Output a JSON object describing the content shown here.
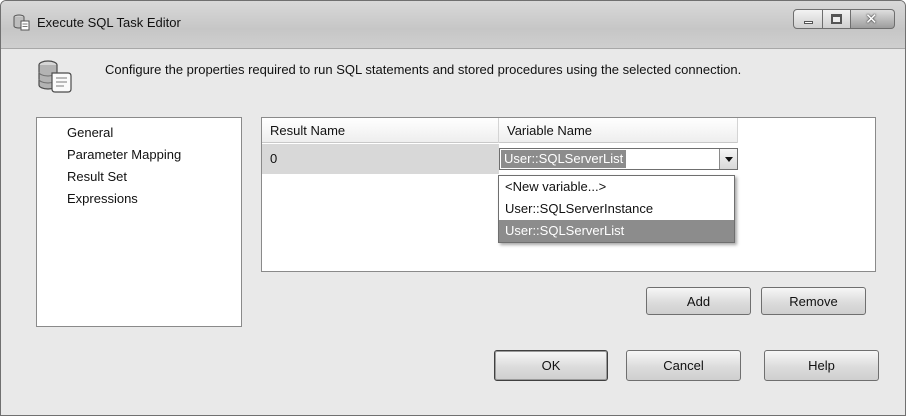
{
  "window": {
    "title": "Execute SQL Task Editor"
  },
  "header": {
    "description": "Configure the properties required to run SQL statements and stored procedures using the selected connection."
  },
  "nav": {
    "items": [
      {
        "label": "General"
      },
      {
        "label": "Parameter Mapping"
      },
      {
        "label": "Result Set"
      },
      {
        "label": "Expressions"
      }
    ]
  },
  "grid": {
    "columns": [
      "Result Name",
      "Variable Name"
    ],
    "rows": [
      {
        "result_name": "0",
        "variable_name": "User::SQLServerList"
      }
    ]
  },
  "dropdown": {
    "options": [
      "<New variable...>",
      "User::SQLServerInstance",
      "User::SQLServerList"
    ],
    "selected": "User::SQLServerList"
  },
  "buttons": {
    "add": "Add",
    "remove": "Remove",
    "ok": "OK",
    "cancel": "Cancel",
    "help": "Help"
  }
}
